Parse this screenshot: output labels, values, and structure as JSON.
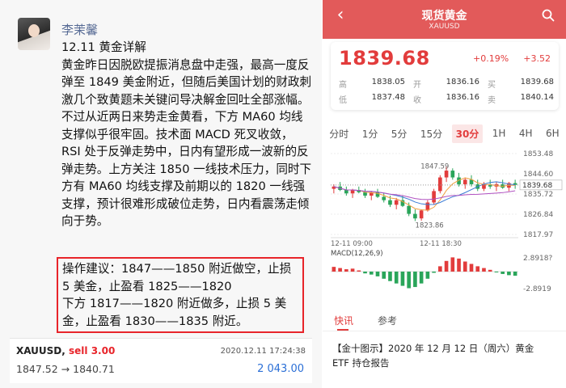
{
  "post": {
    "author": "李茉馨",
    "paragraphs": [
      "12.11 黄金详解",
      "黄金昨日因脱欧提振消息盘中走强，最高一度反弹至 1849 美金附近，但随后美国计划的财政刺激几个致黄题未关键问导决解金回吐全部涨幅。不过从近两日来势走金黄看，下方 MA60 均线支撑似乎很牢固。技术面 MACD 死叉收敛，RSI 处于反弹走势中，日内有望形成一波新的反弹走势。上方关注 1850 一线技术压力，同时下方有 MA60 均线支撑及前期以的 1820 一线强支撑，预计很难形成破位走势，日内看震荡走倾向于势。"
    ],
    "advice_lines": [
      "操作建议：1847——1850 附近做空，止损 5 美金，止盈看 1825——1820",
      "下方 1817——1820 附近做多，止损 5 美金，止盈看 1830——1835 附近。"
    ],
    "trade": {
      "symbol": "XAUUSD,",
      "side": "sell 3.00",
      "time": "2020.12.11 17:24:38",
      "prices": "1847.52 → 1840.71",
      "profit": "2 043.00"
    }
  },
  "app": {
    "title": "现货黄金",
    "subtitle": "XAUUSD",
    "price": "1839.68",
    "pct": "+0.19%",
    "change": "+3.52",
    "stats": [
      [
        {
          "label": "高",
          "value": "1838.05"
        },
        {
          "label": "开",
          "value": "1836.16"
        },
        {
          "label": "买",
          "value": "1839.68"
        }
      ],
      [
        {
          "label": "低",
          "value": "1837.48"
        },
        {
          "label": "收",
          "value": "1836.16"
        },
        {
          "label": "卖",
          "value": "1840.14"
        }
      ]
    ],
    "tabs": [
      "分时",
      "1分",
      "5分",
      "15分",
      "30分",
      "1H",
      "4H",
      "6H"
    ],
    "active_tab": "30分",
    "news_tabs": [
      "快讯",
      "参考"
    ],
    "news_item": "【金十图示】2020 年 12 月 12 日（周六）黄金 ETF 持仓报告"
  },
  "colors": {
    "up": "#e23c3c",
    "down": "#2aa55a",
    "nav": "#e25a5a"
  },
  "chart_data": {
    "type": "candlestick",
    "price_axis_ticks": [
      "1853.48",
      "1844.60",
      "1835.72",
      "1826.84",
      "1817.97"
    ],
    "ylim": [
      1817.97,
      1853.48
    ],
    "current_price_label": "1839.68",
    "annotations": [
      "1847.59",
      "1823.86"
    ],
    "time_labels": [
      "12-11 09:00",
      "12-11 18:30"
    ],
    "indicator_label": "MACD(12,26,9)",
    "indicator_ticks": [
      "2.8918?",
      "-2.8919"
    ],
    "candles": [
      [
        1838,
        1840,
        1836,
        1839
      ],
      [
        1839,
        1841,
        1837,
        1837.5
      ],
      [
        1837.5,
        1839,
        1835,
        1836
      ],
      [
        1836,
        1838,
        1834,
        1837.5
      ],
      [
        1837.5,
        1839,
        1836,
        1836.5
      ],
      [
        1836.5,
        1838,
        1834,
        1835
      ],
      [
        1835,
        1837,
        1833,
        1836.5
      ],
      [
        1836.5,
        1838,
        1834,
        1834.5
      ],
      [
        1834.5,
        1836,
        1832,
        1833
      ],
      [
        1833,
        1835,
        1830,
        1831
      ],
      [
        1831,
        1834,
        1829,
        1833
      ],
      [
        1833,
        1835,
        1830,
        1830.5
      ],
      [
        1830.5,
        1832,
        1826,
        1827
      ],
      [
        1827,
        1829,
        1823.86,
        1825
      ],
      [
        1825,
        1829,
        1824,
        1828.5
      ],
      [
        1828.5,
        1833,
        1828,
        1832
      ],
      [
        1832,
        1838,
        1831,
        1837
      ],
      [
        1837,
        1844,
        1836,
        1843
      ],
      [
        1843,
        1847.59,
        1841,
        1846
      ],
      [
        1846,
        1847,
        1842,
        1843
      ],
      [
        1843,
        1845,
        1839,
        1840
      ],
      [
        1840,
        1843,
        1838,
        1842
      ],
      [
        1842,
        1844,
        1839,
        1840
      ],
      [
        1840,
        1842,
        1837,
        1838
      ],
      [
        1838,
        1841,
        1837,
        1840
      ],
      [
        1840,
        1842,
        1838,
        1839
      ],
      [
        1839,
        1841,
        1837,
        1840
      ],
      [
        1840,
        1842,
        1838,
        1838.5
      ],
      [
        1838.5,
        1841,
        1837,
        1840.5
      ],
      [
        1840.5,
        1842,
        1838,
        1839.7
      ]
    ],
    "macd_bars": [
      0.8,
      0.6,
      0.4,
      0.5,
      0.2,
      -0.3,
      -0.5,
      -0.8,
      -1.2,
      -1.6,
      -2.0,
      -2.4,
      -2.8,
      -2.6,
      -2.0,
      -1.2,
      -0.2,
      0.9,
      1.8,
      2.4,
      2.2,
      1.7,
      1.3,
      0.9,
      0.6,
      0.3,
      -0.1,
      -0.4,
      -0.6,
      -0.7
    ]
  }
}
